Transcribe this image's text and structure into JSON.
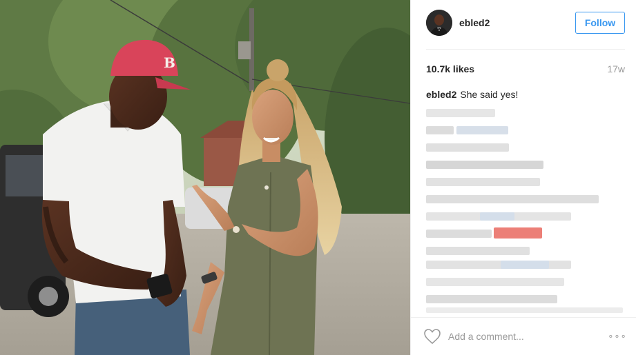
{
  "post": {
    "author": {
      "username": "ebled2"
    },
    "follow_label": "Follow",
    "likes": "10.7k likes",
    "age": "17w",
    "caption": {
      "author": "ebled2",
      "text": "She said yes!"
    },
    "comment_placeholder": "Add a comment...",
    "more_label": "∘∘∘",
    "icons": {
      "like": "heart-outline-icon",
      "more": "ellipsis-icon"
    },
    "colors": {
      "accent": "#3897f0",
      "muted": "#999999",
      "text": "#262626"
    }
  }
}
